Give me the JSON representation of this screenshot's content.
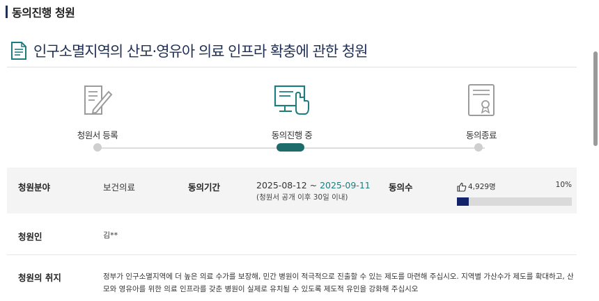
{
  "section": {
    "title": "동의진행 청원"
  },
  "petition": {
    "title": "인구소멸지역의 산모·영유아 의료 인프라 확충에 관한 청원"
  },
  "steps": [
    {
      "label": "청원서 등록",
      "icon": "document-pen-icon"
    },
    {
      "label": "동의진행 중",
      "icon": "computer-click-icon"
    },
    {
      "label": "동의종료",
      "icon": "certificate-icon"
    }
  ],
  "info": {
    "category_label": "청원분야",
    "category_value": "보건의료",
    "period_label": "동의기간",
    "period_start": "2025-08-12 ~ ",
    "period_end": "2025-09-11",
    "period_note": "(청원서 공개 이후 30일 이내)",
    "consent_label": "동의수",
    "consent_count": "4,929명",
    "consent_percent": "10%",
    "progress": 0.1,
    "petitioner_label": "청원인",
    "petitioner_value": "김**",
    "purpose_label": "청원의 취지",
    "purpose_text": "정부가 인구소멸지역에 더 높은 의료 수가를 보장해, 민간 병원이 적극적으로 진출할 수 있는 제도를 마련해 주십시오. 지역별 가산수가 제도를 확대하고, 산모와 영유아를 위한 의료 인프라를 갖춘 병원이 실제로 유치될 수 있도록 제도적 유인을 강화해 주십시오"
  },
  "colors": {
    "accent": "#1e6b6b",
    "progress": "#13236a",
    "title": "#1f2f55"
  }
}
